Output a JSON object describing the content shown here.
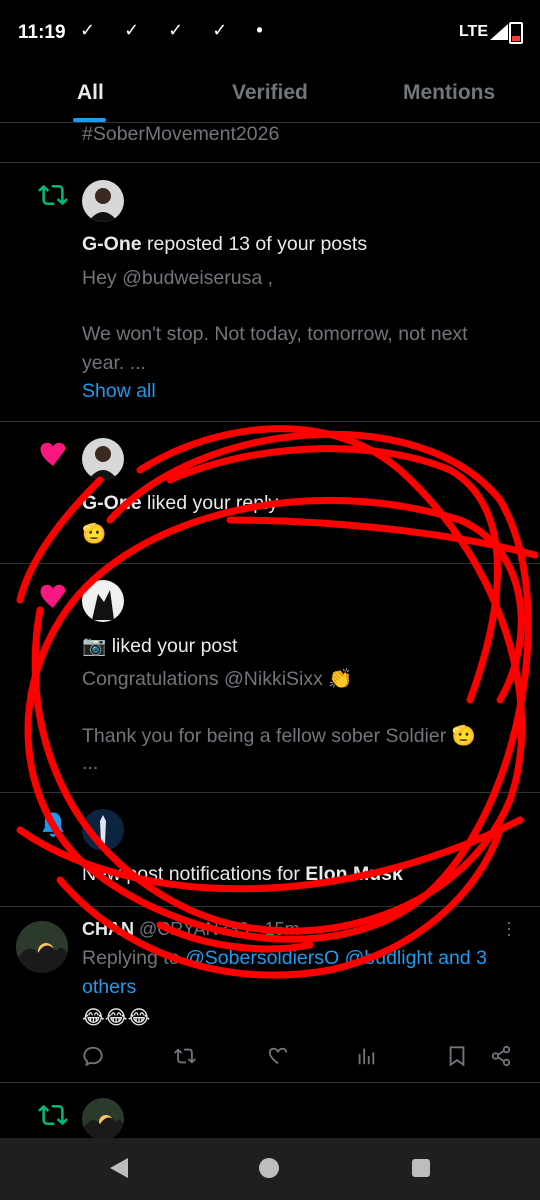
{
  "status": {
    "time": "11:19",
    "checks": "✓ ✓ ✓ ✓ •",
    "network": "LTE"
  },
  "tabs": [
    {
      "label": "All"
    },
    {
      "label": "Verified"
    },
    {
      "label": "Mentions"
    }
  ],
  "items": {
    "prev_hashtag": "#SoberMovement2026",
    "repost": {
      "user": "G-One",
      "action": " reposted 13 of your posts",
      "line1": "Hey @budweiserusa ,",
      "line2": "We won't stop. Not today, tomorrow, not next",
      "line3": "year. ...",
      "show_all": "Show all"
    },
    "like_reply": {
      "user": "G-One",
      "action": " liked your reply",
      "text": "🫡"
    },
    "like_post": {
      "user": "📷",
      "action": " liked your post",
      "line1": "Congratulations @NikkiSixx 👏",
      "line2": "Thank you for being a fellow sober Soldier 🫡",
      "line3": "..."
    },
    "notify": {
      "prefix": "New post notifications for ",
      "user": "Elon Musk"
    },
    "reply": {
      "name": "CHAN",
      "handle": "@CRYAN333 · 15m",
      "replying": "Replying to ",
      "mentions": "@SobersoldiersO @budlight and 3",
      "mentions2": "others",
      "text": "😂😂😂"
    }
  },
  "colors": {
    "like": "#f91880",
    "repost": "#00ba7c",
    "bell": "#1d9bf0",
    "link": "#1d9bf0",
    "scribble": "#ff0000"
  }
}
